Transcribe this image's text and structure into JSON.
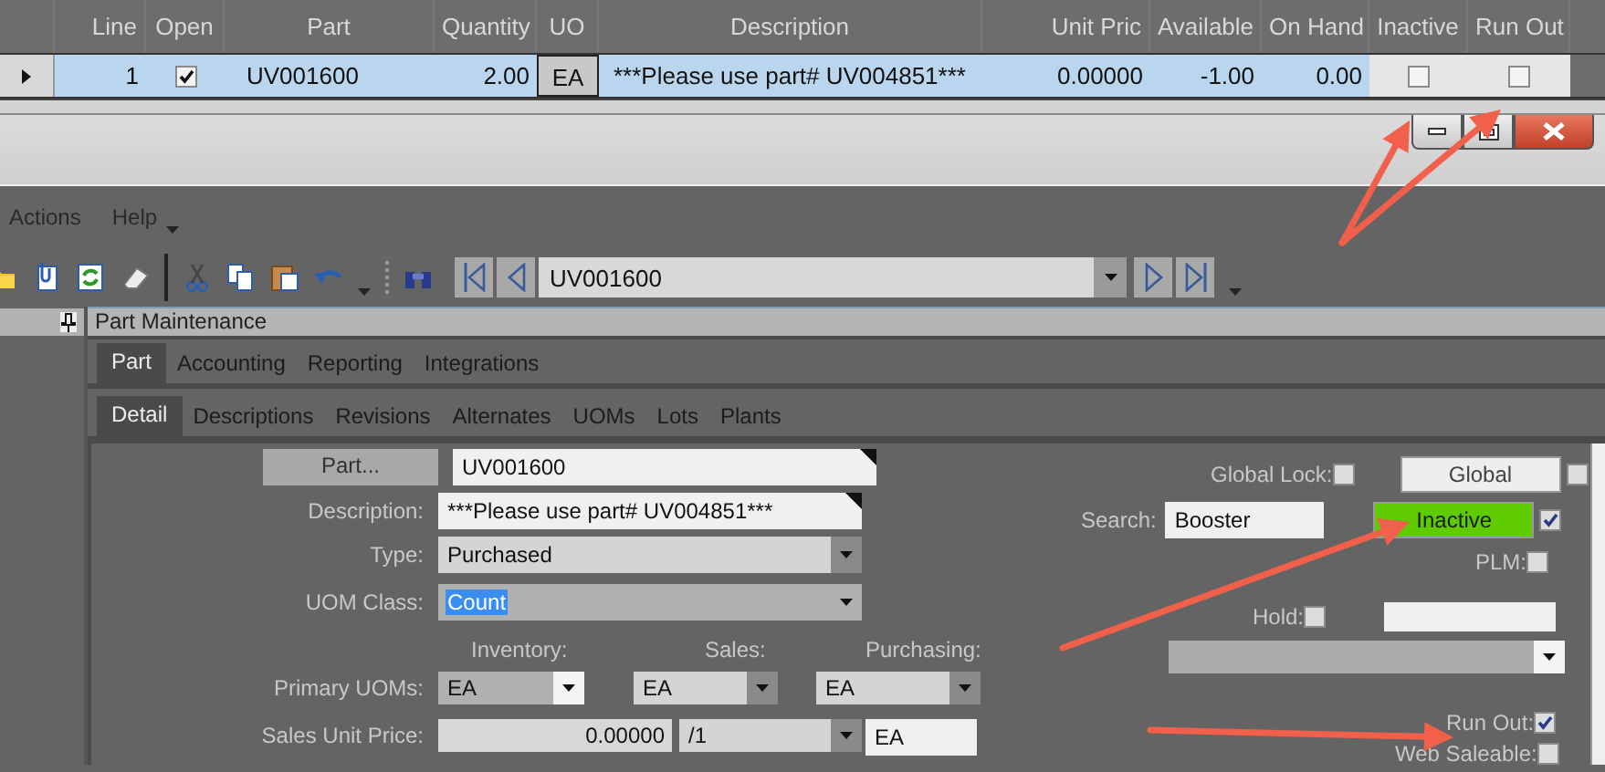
{
  "grid": {
    "columns": [
      "Line",
      "Open",
      "Part",
      "Quantity",
      "UO",
      "Description",
      "Unit Pric",
      "Available",
      "On Hand",
      "Inactive",
      "Run Out"
    ],
    "rows": [
      {
        "selected": true,
        "line": "1",
        "open": true,
        "part": "UV001600",
        "quantity": "2.00",
        "uom": "EA",
        "description": "***Please use part# UV004851***",
        "unit_price": "0.00000",
        "available": "-1.00",
        "on_hand": "0.00",
        "inactive": false,
        "run_out": false
      }
    ]
  },
  "menu": [
    "Actions",
    "Help"
  ],
  "toolbar": {
    "part_number": "UV001600"
  },
  "panel_title": "Part Maintenance",
  "tabs": [
    {
      "label": "Part",
      "selected": true
    },
    {
      "label": "Accounting",
      "selected": false
    },
    {
      "label": "Reporting",
      "selected": false
    },
    {
      "label": "Integrations",
      "selected": false
    }
  ],
  "subtabs": [
    {
      "label": "Detail",
      "selected": true
    },
    {
      "label": "Descriptions",
      "selected": false
    },
    {
      "label": "Revisions",
      "selected": false
    },
    {
      "label": "Alternates",
      "selected": false
    },
    {
      "label": "UOMs",
      "selected": false
    },
    {
      "label": "Lots",
      "selected": false
    },
    {
      "label": "Plants",
      "selected": false
    }
  ],
  "form": {
    "part_button": "Part...",
    "part": "UV001600",
    "description_label": "Description:",
    "description": "***Please use part# UV004851***",
    "type_label": "Type:",
    "type": "Purchased",
    "uom_class_label": "UOM Class:",
    "uom_class": "Count",
    "uom_headers": [
      "Inventory:",
      "Sales:",
      "Purchasing:"
    ],
    "primary_uoms_label": "Primary UOMs:",
    "primary_uoms": [
      "EA",
      "EA",
      "EA"
    ],
    "sales_unit_price_label": "Sales Unit Price:",
    "sales_unit_price": "0.00000",
    "price_per": "/1",
    "price_uom": "EA",
    "global_lock": {
      "label": "Global Lock:",
      "checked": false
    },
    "search_label": "Search:",
    "search": "Booster",
    "global": {
      "label": "Global",
      "on": false,
      "checked": false
    },
    "inactive": {
      "label": "Inactive",
      "on": true,
      "checked": true
    },
    "plm": {
      "label": "PLM:",
      "checked": false
    },
    "hold": {
      "label": "Hold:",
      "checked": false
    },
    "run_out": {
      "label": "Run Out:",
      "checked": true
    },
    "web_saleable": {
      "label": "Web Saleable:",
      "checked": false
    }
  }
}
